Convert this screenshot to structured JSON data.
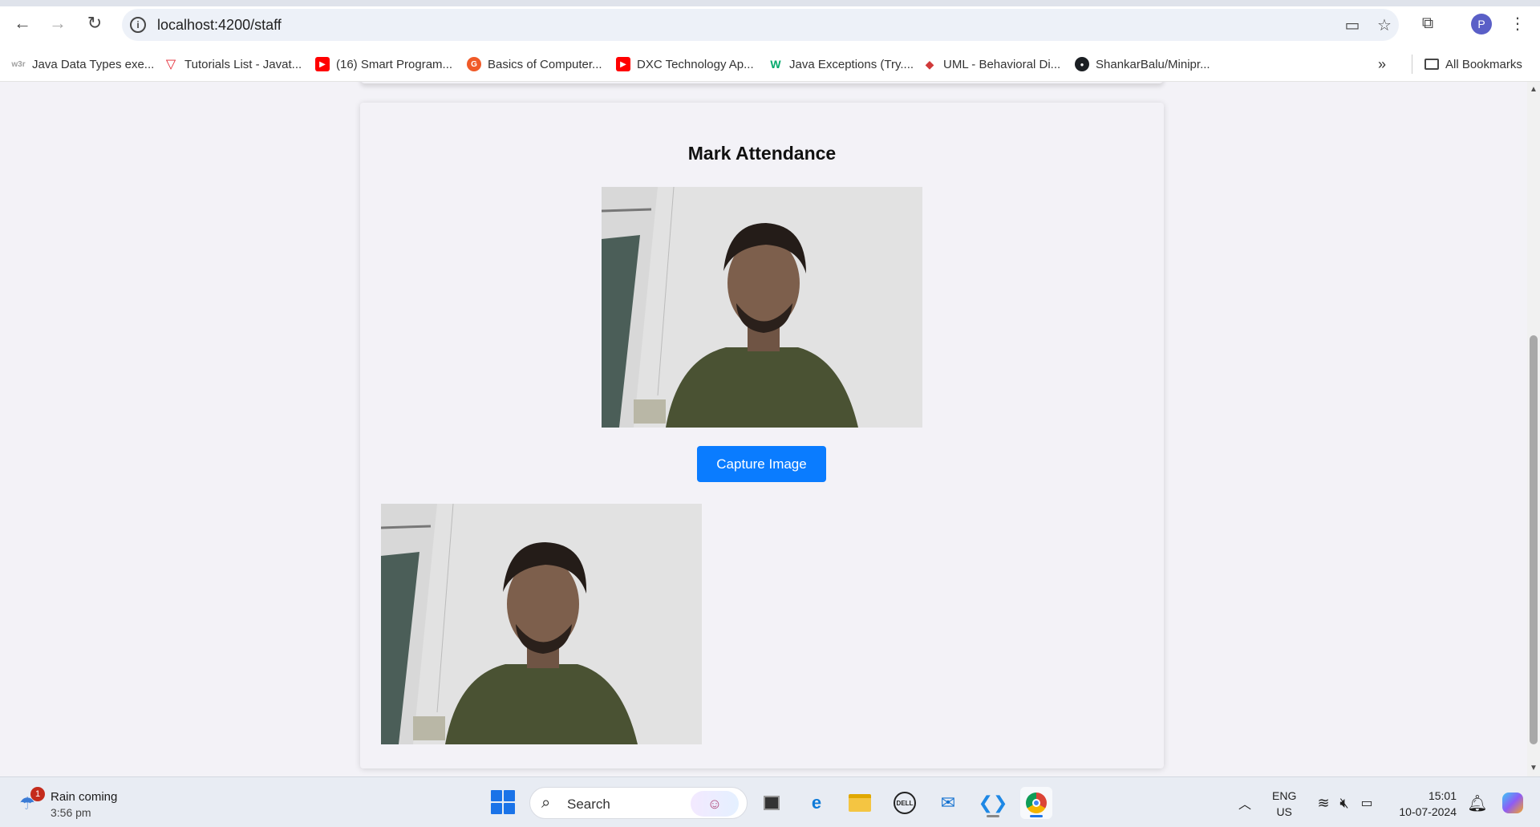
{
  "browser": {
    "url": "localhost:4200/staff",
    "profile_initial": "P",
    "bookmarks": [
      {
        "label": "Java Data Types exe...",
        "icon": "w3schools-icon",
        "icon_text": "w3r",
        "color": "#a0a0a0"
      },
      {
        "label": "Tutorials List - Javat...",
        "icon": "javatpoint-icon",
        "icon_text": "▽",
        "color": "#e3202c"
      },
      {
        "label": "(16) Smart Program...",
        "icon": "youtube-icon",
        "icon_text": "▶",
        "color": "#ff0000"
      },
      {
        "label": "Basics of Computer...",
        "icon": "geeks-icon",
        "icon_text": "G",
        "color": "#f05a28"
      },
      {
        "label": "DXC Technology Ap...",
        "icon": "youtube-icon",
        "icon_text": "▶",
        "color": "#ff0000"
      },
      {
        "label": "Java Exceptions (Try....",
        "icon": "w3-green-icon",
        "icon_text": "W",
        "color": "#04aa6d"
      },
      {
        "label": "UML - Behavioral Di...",
        "icon": "uml-diamond-icon",
        "icon_text": "◆",
        "color": "#d03a3a"
      },
      {
        "label": "ShankarBalu/Minipr...",
        "icon": "github-icon",
        "icon_text": "●",
        "color": "#1b1f23"
      }
    ],
    "all_bookmarks_label": "All Bookmarks"
  },
  "page": {
    "heading": "Mark Attendance",
    "capture_button": "Capture Image"
  },
  "taskbar": {
    "weather_title": "Rain coming",
    "weather_time": "3:56 pm",
    "weather_badge": "1",
    "search_label": "Search",
    "lang_top": "ENG",
    "lang_bottom": "US",
    "time": "15:01",
    "date": "10-07-2024"
  }
}
